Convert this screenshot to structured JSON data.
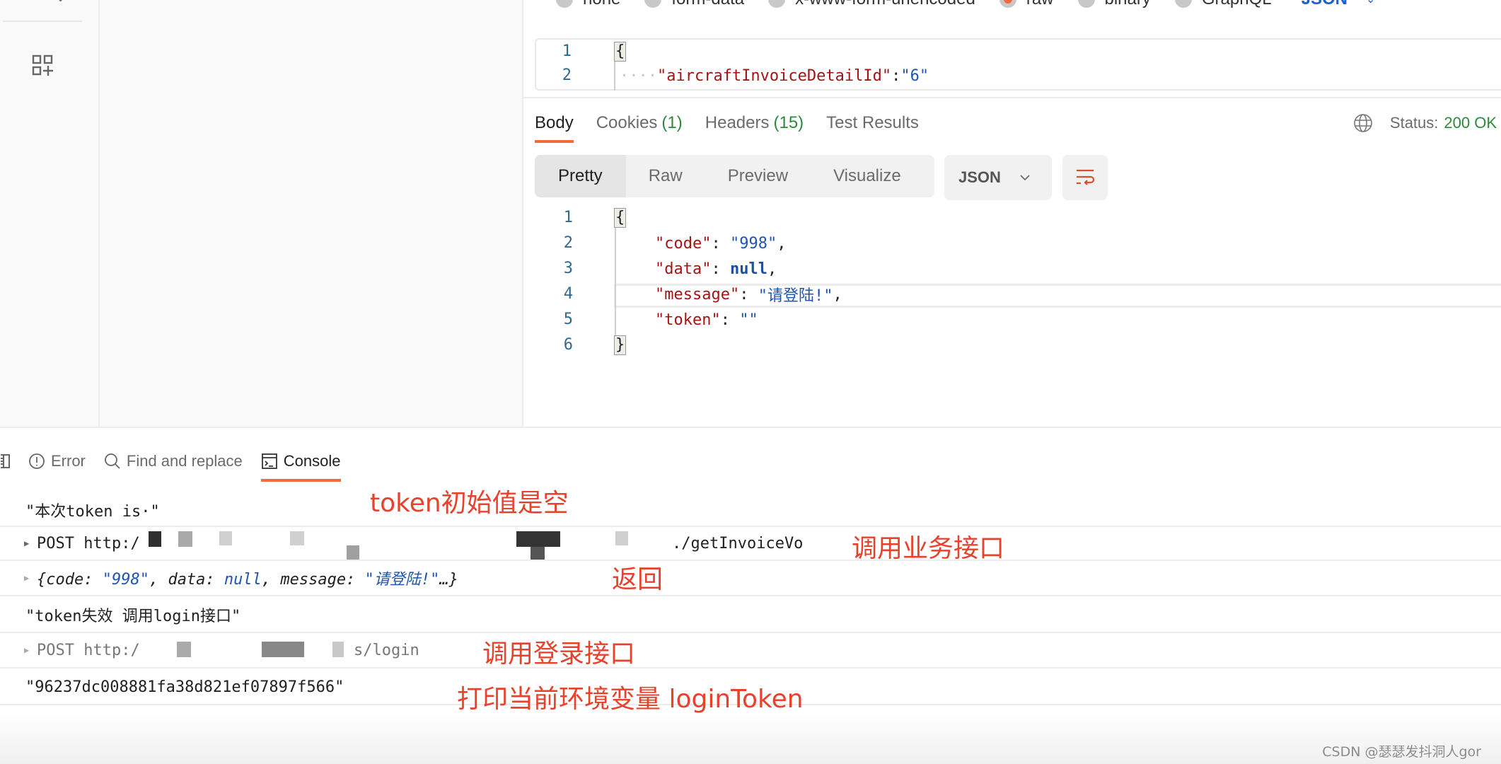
{
  "sidebar": {
    "apps_icon": "apps-add-icon"
  },
  "request": {
    "body_types": [
      {
        "label": "none",
        "selected": false
      },
      {
        "label": "form-data",
        "selected": false
      },
      {
        "label": "x-www-form-urlencoded",
        "selected": false
      },
      {
        "label": "raw",
        "selected": true
      },
      {
        "label": "binary",
        "selected": false
      },
      {
        "label": "GraphQL",
        "selected": false
      }
    ],
    "format": "JSON",
    "editor": {
      "line_numbers": [
        "1",
        "2"
      ],
      "lines": [
        {
          "open": "{"
        },
        {
          "key": "\"aircraftInvoiceDetailId\"",
          "colon": ":",
          "value": "\"6\""
        }
      ]
    }
  },
  "response": {
    "tabs": [
      {
        "label": "Body",
        "count": "",
        "active": true
      },
      {
        "label": "Cookies",
        "count": "(1)",
        "active": false
      },
      {
        "label": "Headers",
        "count": "(15)",
        "active": false
      },
      {
        "label": "Test Results",
        "count": "",
        "active": false
      }
    ],
    "status_label": "Status:",
    "status_value": "200 OK",
    "view_modes": [
      "Pretty",
      "Raw",
      "Preview",
      "Visualize"
    ],
    "active_view": "Pretty",
    "format": "JSON",
    "line_numbers": [
      "1",
      "2",
      "3",
      "4",
      "5",
      "6"
    ],
    "body": {
      "open": "{",
      "close": "}",
      "entries": [
        {
          "key": "\"code\"",
          "value": "\"998\"",
          "type": "string",
          "comma": ","
        },
        {
          "key": "\"data\"",
          "value": "null",
          "type": "null",
          "comma": ","
        },
        {
          "key": "\"message\"",
          "value": "\"请登陆!\"",
          "type": "string",
          "comma": ","
        },
        {
          "key": "\"token\"",
          "value": "\"\"",
          "type": "string",
          "comma": ""
        }
      ]
    }
  },
  "console": {
    "tabs": [
      {
        "label": "Error",
        "icon": "error-icon"
      },
      {
        "label": "Find and replace",
        "icon": "search-icon"
      },
      {
        "label": "Console",
        "icon": "terminal-icon",
        "active": true
      }
    ],
    "rows": [
      {
        "text": "\"本次token is·\"",
        "expandable": false
      },
      {
        "method": "POST",
        "url_start": "http:/",
        "url_end": "./getInvoiceVo",
        "expandable": true
      },
      {
        "obj_open": "{code: ",
        "code": "\"998\"",
        "mid1": ", data: ",
        "data": "null",
        "mid2": ", message: ",
        "message": "\"请登陆!\"",
        "obj_close": "…}",
        "expandable": true
      },
      {
        "text": "\"token失效 调用login接口\"",
        "expandable": false
      },
      {
        "method": "POST",
        "url_start": "http:/",
        "url_end": "s/login",
        "expandable": true
      },
      {
        "text": "\"96237dc008881fa38d821ef07897f566\"",
        "expandable": false
      }
    ]
  },
  "annotations": [
    "token初始值是空",
    "调用业务接口",
    "返回",
    "调用登录接口",
    "打印当前环境变量 loginToken"
  ],
  "watermark": "CSDN @瑟瑟发抖洞人gor",
  "colors": {
    "accent": "#f26b3a",
    "success": "#2d8a3a",
    "annotation": "#e8412c",
    "json_key": "#a31515",
    "json_string": "#1f55b0"
  }
}
